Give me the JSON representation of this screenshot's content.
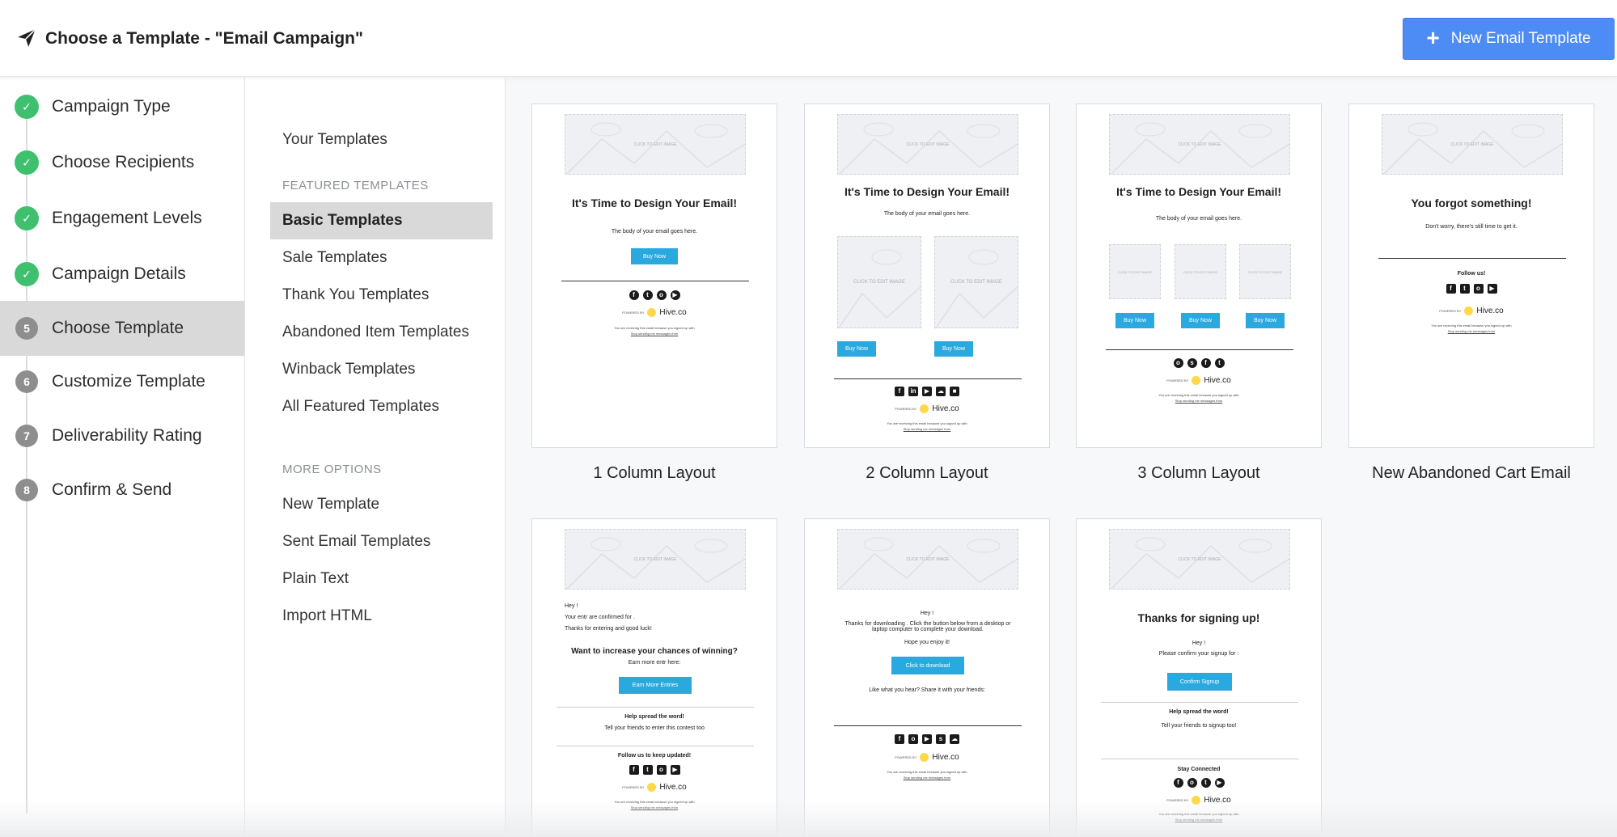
{
  "header": {
    "title": "Choose a Template - \"Email Campaign\"",
    "logo_icon": "paper-plane-icon",
    "new_button_label": "New Email Template",
    "new_button_color": "#4d8bf5"
  },
  "steps": [
    {
      "number": "1",
      "label": "Campaign Type",
      "status": "done"
    },
    {
      "number": "2",
      "label": "Choose Recipients",
      "status": "done"
    },
    {
      "number": "3",
      "label": "Engagement Levels",
      "status": "done"
    },
    {
      "number": "4",
      "label": "Campaign Details",
      "status": "done"
    },
    {
      "number": "5",
      "label": "Choose Template",
      "status": "active"
    },
    {
      "number": "6",
      "label": "Customize Template",
      "status": "pending"
    },
    {
      "number": "7",
      "label": "Deliverability Rating",
      "status": "pending"
    },
    {
      "number": "8",
      "label": "Confirm & Send",
      "status": "pending"
    }
  ],
  "categories": {
    "your_templates": "Your Templates",
    "featured_heading": "FEATURED TEMPLATES",
    "featured": [
      "Basic Templates",
      "Sale Templates",
      "Thank You Templates",
      "Abandoned Item Templates",
      "Winback Templates",
      "All Featured Templates"
    ],
    "active": "Basic Templates",
    "more_heading": "MORE OPTIONS",
    "more": [
      "New Template",
      "Sent Email Templates",
      "Plain Text",
      "Import HTML"
    ]
  },
  "templates": {
    "t1": {
      "name": "1 Column Layout",
      "headline": "It's Time to Design Your Email!",
      "body": "The body of your email goes here.",
      "button": "Buy Now"
    },
    "t2": {
      "name": "2 Column Layout",
      "headline": "It's Time to Design Your Email!",
      "body": "The body of your email goes here.",
      "button": "Buy Now",
      "image_label": "CLICK TO EDIT IMAGE"
    },
    "t3": {
      "name": "3 Column Layout",
      "headline": "It's Time to Design Your Email!",
      "body": "The body of your email goes here.",
      "button": "Buy Now",
      "image_label": "CLICK TO EDIT IMAGE"
    },
    "t4": {
      "name": "New Abandoned Cart Email",
      "headline": "You forgot something!",
      "body": "Don't worry, there's still time to get it.",
      "follow": "Follow us!"
    },
    "t5": {
      "greeting": "Hey !",
      "line1": "Your entr are confirmed for .",
      "line2": "Thanks for entering and good luck!",
      "headline": "Want to increase your chances of winning?",
      "earn": "Earn more entr here:",
      "button": "Earn More Entries",
      "spread": "Help spread the word!",
      "tell": "Tell your friends to enter this contest too",
      "follow": "Follow us to keep updated!"
    },
    "t6": {
      "greeting": "Hey !",
      "line1": "Thanks for downloading . Click the button below from a desktop or laptop computer to complete your download.",
      "line2": "Hope you enjoy it!",
      "button": "Click to download",
      "share": "Like what you hear? Share it with your friends:"
    },
    "t7": {
      "headline": "Thanks for signing up!",
      "greeting": "Hey !",
      "line1": "Please confirm your signup for :",
      "button": "Confirm Signup",
      "spread": "Help spread the word!",
      "tell": "Tell your friends to signup too!",
      "stay": "Stay Connected"
    },
    "hero_label": "CLICK TO EDIT IMAGE",
    "powered_by": "POWERED BY",
    "brand": "Hive.co",
    "footer_line": "You are receiving this email because you signed up with",
    "footer_link": "Stop sending me messages from"
  }
}
